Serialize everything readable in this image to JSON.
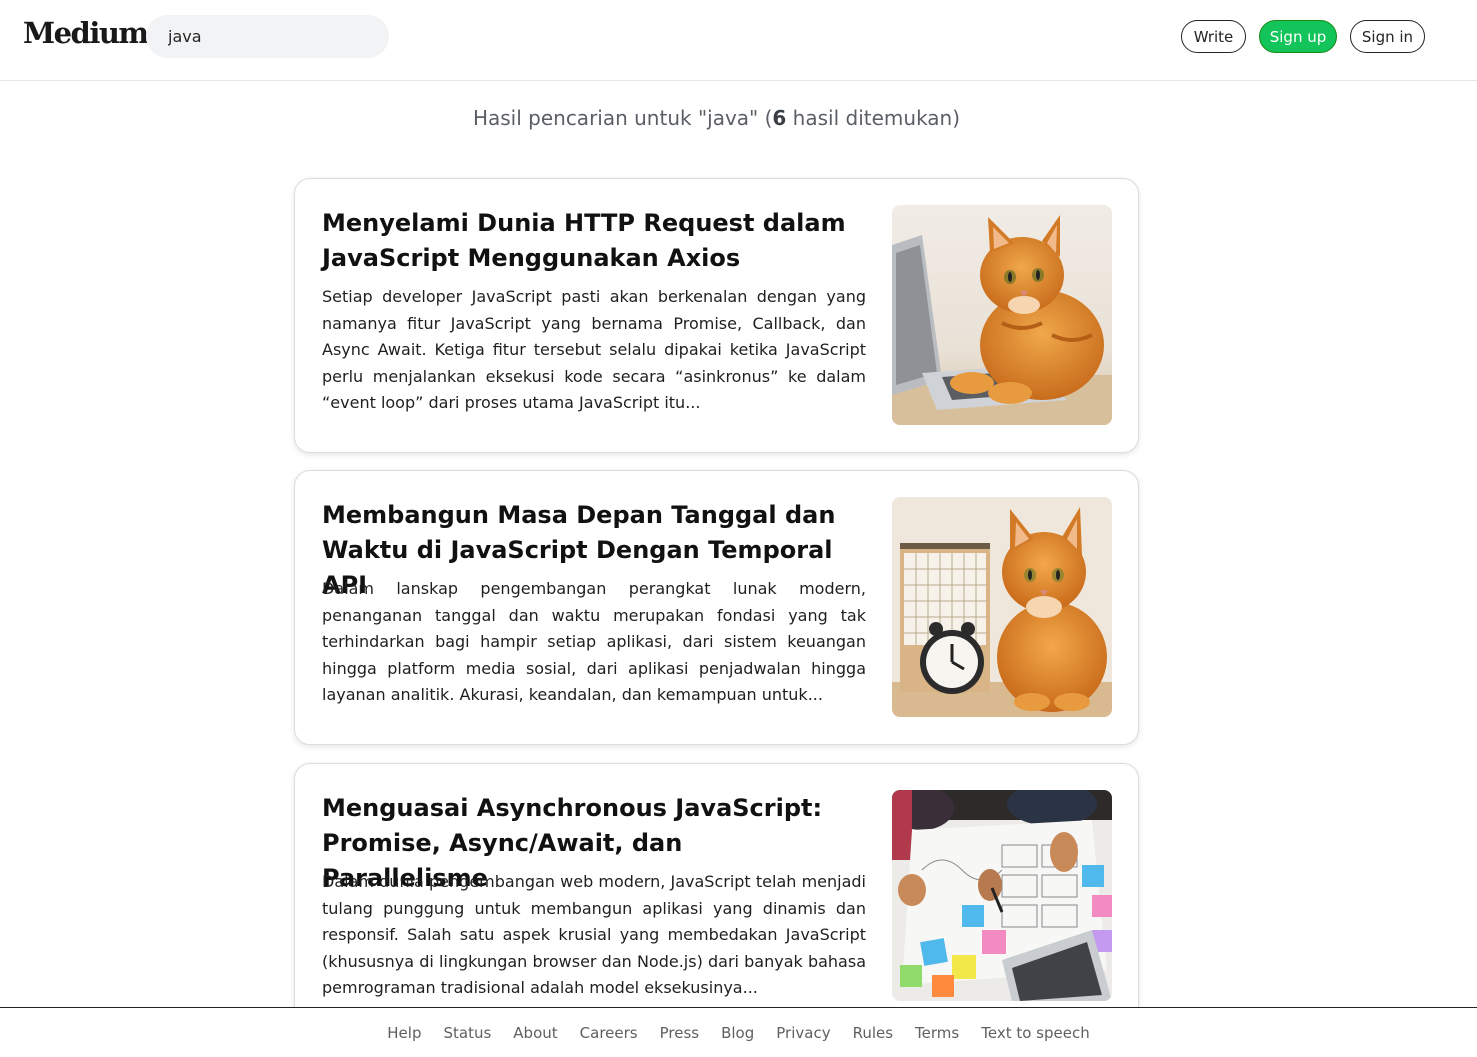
{
  "header": {
    "logo": "Medium",
    "search_value": "java",
    "write_label": "Write",
    "signup_label": "Sign up",
    "signin_label": "Sign in"
  },
  "summary": {
    "prefix": "Hasil pencarian untuk \"java\" (",
    "count": "6",
    "suffix": " hasil ditemukan)"
  },
  "articles": [
    {
      "title": "Menyelami Dunia HTTP Request dalam JavaScript Menggunakan Axios",
      "excerpt": "Setiap developer JavaScript pasti akan berkenalan dengan yang namanya fitur JavaScript yang bernama Promise, Callback, dan Async Await. Ketiga fitur tersebut selalu dipakai ketika JavaScript perlu menjalankan eksekusi kode secara “asinkronus” ke dalam “event loop” dari proses utama JavaScript itu...",
      "image": "cat-with-laptop-image"
    },
    {
      "title": "Membangun Masa Depan Tanggal dan Waktu di JavaScript Dengan Temporal API",
      "excerpt": "Dalam lanskap pengembangan perangkat lunak modern, penanganan tanggal dan waktu merupakan fondasi yang tak terhindarkan bagi hampir setiap aplikasi, dari sistem keuangan hingga platform media sosial, dari aplikasi penjadwalan hingga layanan analitik. Akurasi, keandalan, dan kemampuan untuk...",
      "image": "cat-with-calendar-clock-image"
    },
    {
      "title": "Menguasai Asynchronous JavaScript: Promise, Async/Await, dan Parallelisme",
      "excerpt": "Dalam dunia pengembangan web modern, JavaScript telah menjadi tulang punggung untuk membangun aplikasi yang dinamis dan responsif. Salah satu aspek krusial yang membedakan JavaScript (khususnya di lingkungan browser dan Node.js) dari banyak bahasa pemrograman tradisional adalah model eksekusinya...",
      "image": "team-planning-sticky-notes-image"
    }
  ],
  "footer": {
    "links": [
      "Help",
      "Status",
      "About",
      "Careers",
      "Press",
      "Blog",
      "Privacy",
      "Rules",
      "Terms",
      "Text to speech"
    ]
  }
}
